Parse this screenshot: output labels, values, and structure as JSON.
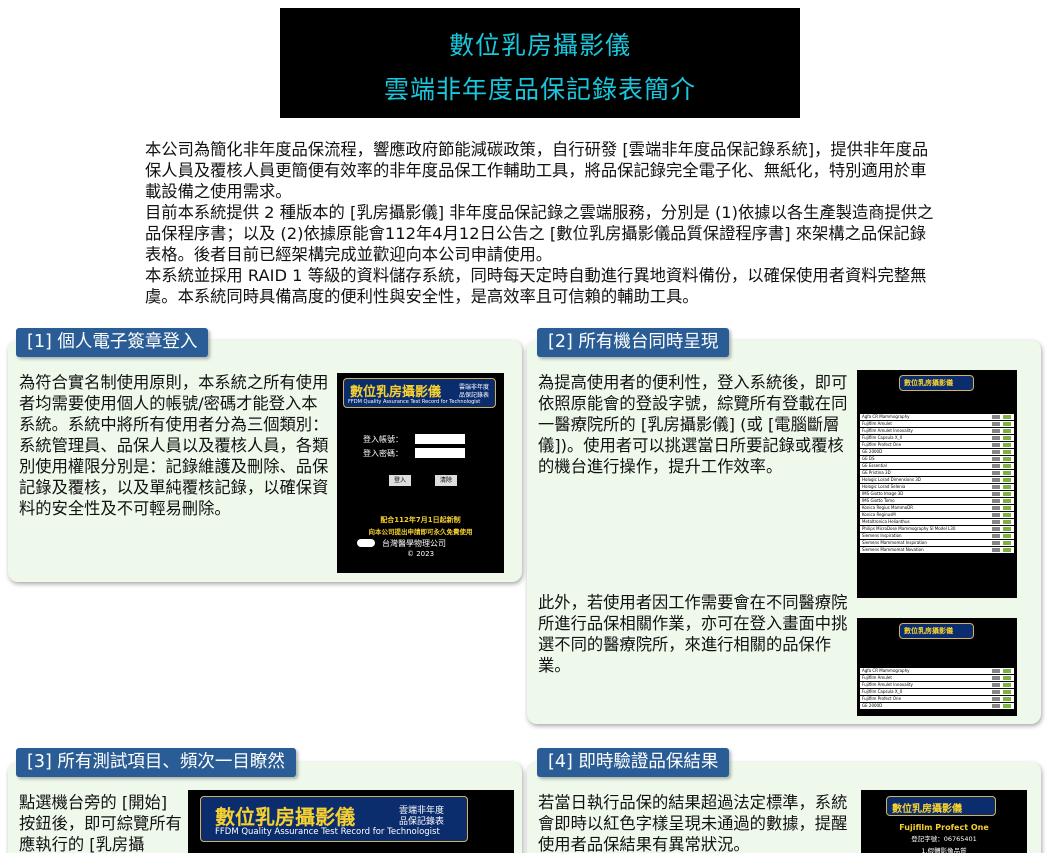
{
  "banner": {
    "line1": "數位乳房攝影儀",
    "line2": "雲端非年度品保記錄表簡介"
  },
  "intro": {
    "p1": "本公司為簡化非年度品保流程，響應政府節能減碳政策，自行研發 [雲端非年度品保記錄系統]，提供非年度品保人員及覆核人員更簡便有效率的非年度品保工作輔助工具，將品保記錄完全電子化、無紙化，特別適用於車載設備之使用需求。",
    "p2": "目前本系統提供 2 種版本的 [乳房攝影儀] 非年度品保記錄之雲端服務，分別是 (1)依據以各生產製造商提供之品保程序書；以及 (2)依據原能會112年4月12日公告之 [數位乳房攝影儀品質保證程序書] 來架構之品保記錄表格。後者目前已經架構完成並歡迎向本公司申請使用。",
    "p3": "本系統並採用 RAID 1 等級的資料儲存系統，同時每天定時自動進行異地資料備份，以確保使用者資料完整無虞。本系統同時具備高度的便利性與安全性，是高效率且可信賴的輔助工具。"
  },
  "sections": [
    {
      "tab": "[1] 個人電子簽章登入",
      "text": "為符合實名制使用原則，本系統之所有使用者均需要使用個人的帳號/密碼才能登入本系統。系統中將所有使用者分為三個類別：系統管理員、品保人員以及覆核人員，各類別使用權限分別是：記錄維護及刪除、品保記錄及覆核，以及單純覆核記錄，以確保資料的安全性及不可輕易刪除。"
    },
    {
      "tab": "[2] 所有機台同時呈現",
      "text": "為提高使用者的便利性，登入系統後，即可依照原能會的登設字號，綜覽所有登載在同一醫療院所的 [乳房攝影儀] (或 [電腦斷層儀])。使用者可以挑選當日所要記錄或覆核的機台進行操作，提升工作效率。",
      "text2": "此外，若使用者因工作需要會在不同醫療院所進行品保相關作業，亦可在登入畫面中挑選不同的醫療院所，來進行相關的品保作業。"
    },
    {
      "tab": "[3] 所有測試項目、頻次一目瞭然",
      "text": "點選機台旁的 [開始] 按鈕後，即可綜覽所有應執行的 [乳房攝"
    },
    {
      "tab": "[4] 即時驗證品保結果",
      "text": "若當日執行品保的結果超過法定標準，系統會即時以紅色字樣呈現未通過的數據，提醒使用者品保結果有異常狀況。"
    }
  ],
  "login_shot": {
    "logo_title": "數位乳房攝影儀",
    "logo_side1": "雲端非年度",
    "logo_side2": "品保記錄表",
    "logo_sub": "FFDM Quality Assurance Test Record for Technologist",
    "account_label": "登入帳號：",
    "password_label": "登入密碼：",
    "login_button": "登入",
    "clear_button": "清除",
    "notice1": "配合112年7月1日起新制",
    "notice2": "向本公司提出申請即可永久免費使用",
    "company": "台灣醫學物理公司",
    "year": "© 2023"
  },
  "list_shot": {
    "logo_title": "數位乳房攝影儀",
    "rows": [
      "Agfa CR Mammography",
      "Fujifilm Amulet",
      "Fujifilm Amulet Innovality",
      "Fujifilm Capsula X_II",
      "Fujifilm Profect One",
      "GE 2000D",
      "GE DS",
      "GE Essential",
      "GE Pristina 3D",
      "Hologic Lorad Dimensions 3D",
      "Hologic Lorad Selenia",
      "IMS Giotto Image 3D",
      "IMS Giotto Tomo",
      "Konica Regius MammoDR",
      "Konica ReginusM",
      "Metaltronica Helianthus",
      "Philips MicroDose Mammography SI Model L30",
      "Siemens Inspiration",
      "Siemens Mammomat Inspiration",
      "Siemens Mammomat Novation"
    ]
  },
  "sel_shot": {
    "logo_title": "數位乳房攝影儀",
    "rows": [
      "Agfa CR Mammography",
      "Fujifilm Amulet",
      "Fujifilm Amulet Innovality",
      "Fujifilm Capsula X_II",
      "Fujifilm Profect One",
      "GE 2000D"
    ]
  },
  "tests_shot": {
    "logo_title": "數位乳房攝影儀",
    "logo_side1": "雲端非年度",
    "logo_side2": "品保記錄表",
    "logo_sub": "FFDM Quality Assurance Test Record for Technologist"
  },
  "result_shot": {
    "logo_title": "數位乳房攝影儀",
    "device": "Fujifilm Profect One",
    "license": "登記字號：06765401",
    "item": "1.假體影像品質"
  }
}
